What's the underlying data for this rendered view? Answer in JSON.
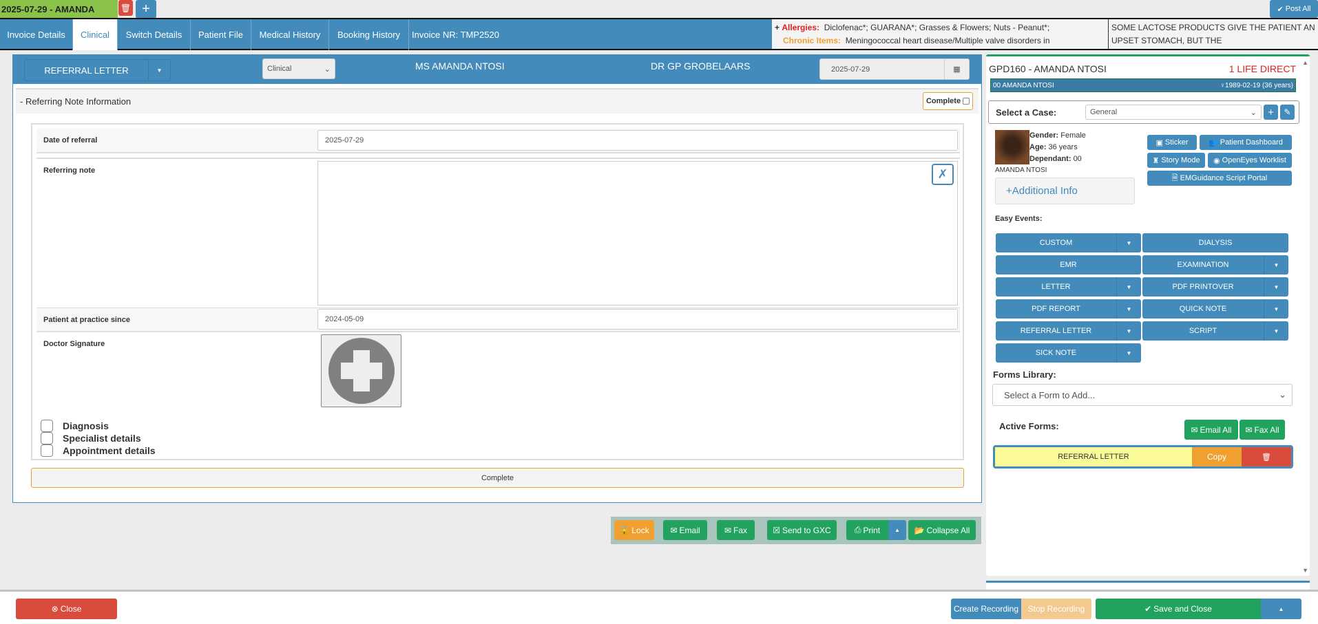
{
  "top": {
    "title": "2025-07-29 - AMANDA",
    "post_all": "Post All"
  },
  "tabs": [
    "Invoice Details",
    "Clinical",
    "Switch Details",
    "Patient File",
    "Medical History",
    "Booking History",
    "Invoice NR: TMP2520"
  ],
  "alerts": {
    "allergies_label": "Allergies:",
    "allergies": "Diclofenac*; GUARANA*; Grasses & Flowers; Nuts - Peanut*;",
    "chronic_label": "Chronic Items:",
    "chronic": "Meningococcal heart disease/Multiple valve disorders in",
    "note": "SOME LACTOSE PRODUCTS GIVE THE PATIENT AN UPSET STOMACH, BUT THE"
  },
  "form_header": {
    "form_type": "REFERRAL LETTER",
    "category": "Clinical",
    "patient": "MS AMANDA NTOSI",
    "doctor": "DR GP GROBELAARS",
    "date": "2025-07-29"
  },
  "section": {
    "title": "-  Referring Note Information",
    "complete_label": "Complete"
  },
  "fields": {
    "date_label": "Date of referral",
    "date_value": "2025-07-29",
    "note_label": "Referring note",
    "note_value": "",
    "since_label": "Patient at practice since",
    "since_value": "2024-05-09",
    "signature_label": "Doctor Signature"
  },
  "checkboxes": [
    "Diagnosis",
    "Specialist details",
    "Appointment details"
  ],
  "complete_button": "Complete",
  "toolbar": {
    "lock": "Lock",
    "email": "Email",
    "fax": "Fax",
    "gxc": "Send to GXC",
    "print": "Print",
    "collapse": "Collapse All"
  },
  "patient": {
    "header": "GPD160 - AMANDA NTOSI",
    "scheme": "1 LIFE DIRECT",
    "bar_name": "00 AMANDA NTOSI",
    "dob": "1989-02-19 (36 years)",
    "case_label": "Select a Case:",
    "case_value": "General",
    "gender_label": "Gender:",
    "gender": "Female",
    "age_label": "Age:",
    "age": "36 years",
    "dep_label": "Dependant:",
    "dep": "00",
    "name": "AMANDA NTOSI",
    "additional": "Additional Info"
  },
  "patient_buttons": {
    "sticker": "Sticker",
    "dashboard": "Patient Dashboard",
    "story": "Story Mode",
    "openeyes": "OpenEyes Worklist",
    "emguidance": "EMGuidance Script Portal"
  },
  "easy_events_label": "Easy Events:",
  "easy_events": [
    {
      "label": "CUSTOM",
      "caret": true
    },
    {
      "label": "DIALYSIS",
      "caret": false
    },
    {
      "label": "EMR",
      "caret": false
    },
    {
      "label": "EXAMINATION",
      "caret": true
    },
    {
      "label": "LETTER",
      "caret": true
    },
    {
      "label": "PDF PRINTOVER",
      "caret": true
    },
    {
      "label": "PDF REPORT",
      "caret": true
    },
    {
      "label": "QUICK NOTE",
      "caret": true
    },
    {
      "label": "REFERRAL LETTER",
      "caret": true
    },
    {
      "label": "SCRIPT",
      "caret": true
    },
    {
      "label": "SICK NOTE",
      "caret": true
    }
  ],
  "forms_library": {
    "label": "Forms Library:",
    "placeholder": "Select a Form to Add..."
  },
  "active_forms": {
    "label": "Active Forms:",
    "email_all": "Email All",
    "fax_all": "Fax All",
    "items": [
      {
        "name": "REFERRAL LETTER",
        "copy": "Copy"
      }
    ]
  },
  "footer": {
    "close": "Close",
    "create_recording": "Create Recording",
    "stop_recording": "Stop Recording",
    "save_close": "Save and Close"
  }
}
